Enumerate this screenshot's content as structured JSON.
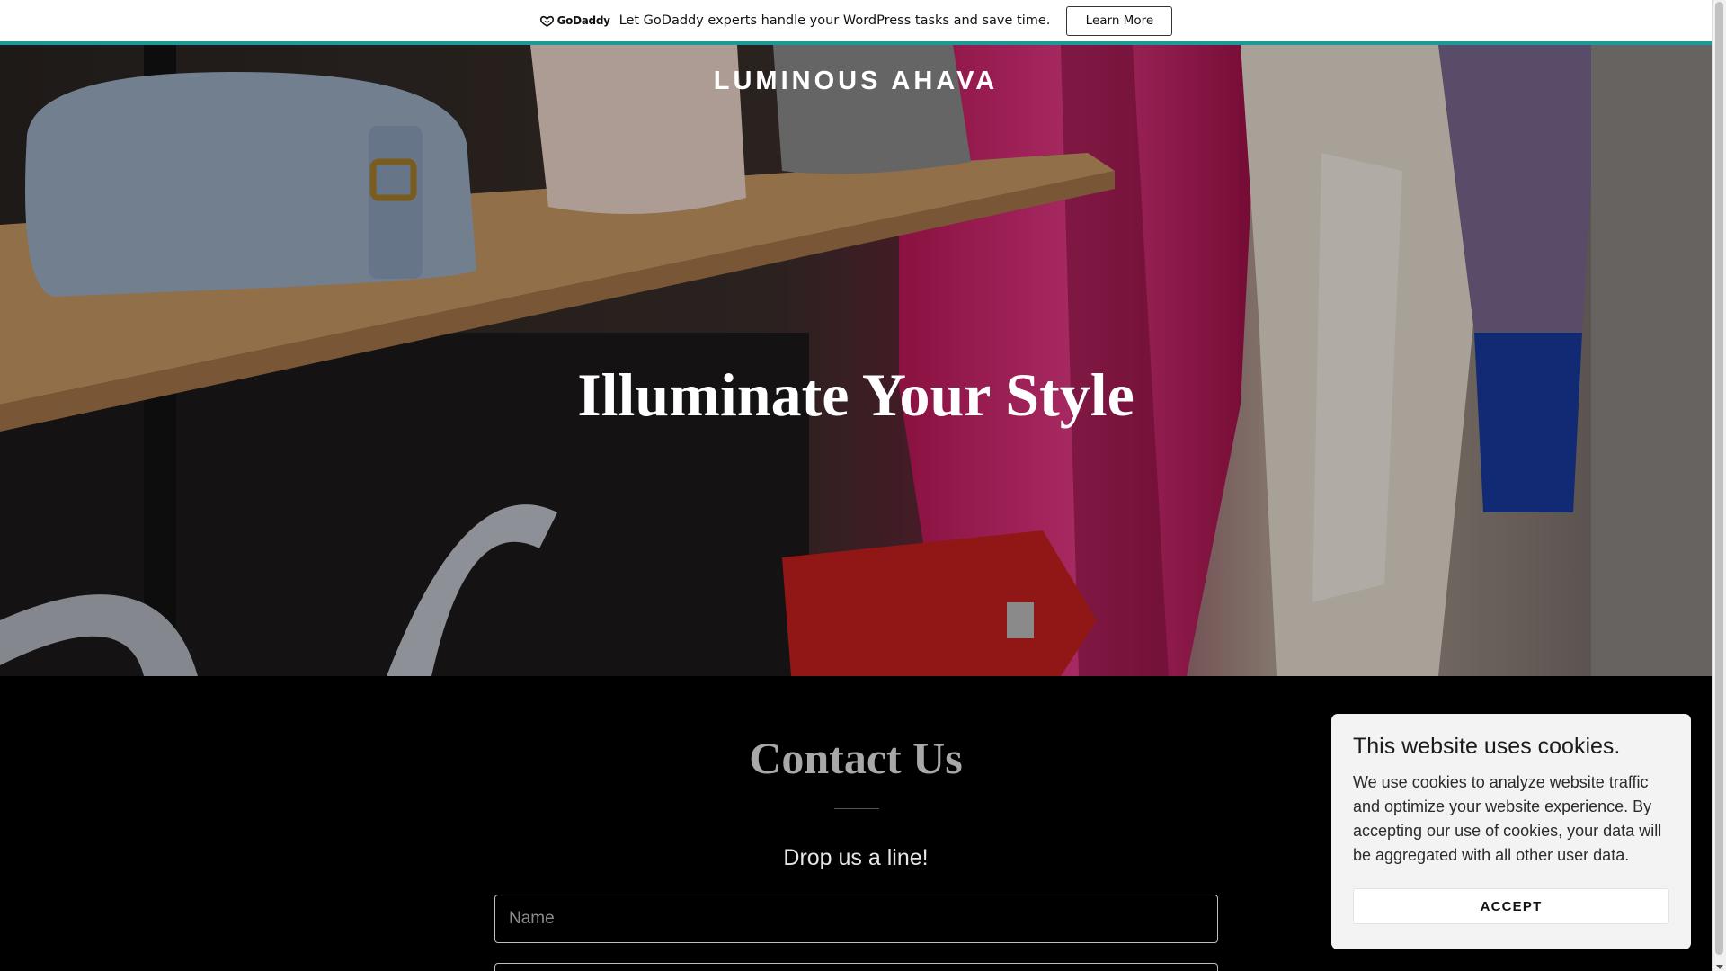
{
  "promo": {
    "logo_text": "GoDaddy",
    "message": "Let GoDaddy experts handle your WordPress tasks and save time.",
    "button_label": "Learn More"
  },
  "hero": {
    "site_title": "LUMINOUS AHAVA",
    "heading": "Illuminate Your Style"
  },
  "contact": {
    "title": "Contact Us",
    "subtitle": "Drop us a line!",
    "name_placeholder": "Name",
    "email_placeholder": ""
  },
  "cookie": {
    "title": "This website uses cookies.",
    "text": "We use cookies to analyze website traffic and optimize your website experience. By accepting our use of cookies, your data will be aggregated with all other user data.",
    "accept_label": "ACCEPT"
  },
  "colors": {
    "promo_accent": "#1a9a9a",
    "page_background": "#000000",
    "cookie_panel": "#f3f3f3"
  }
}
